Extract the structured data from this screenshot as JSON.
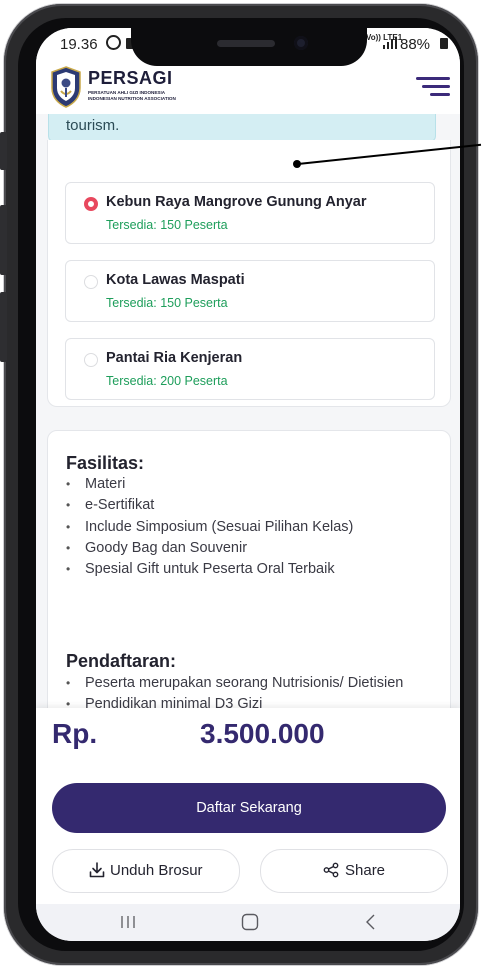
{
  "status_bar": {
    "time": "19.36",
    "network": "Vo)) LTE1",
    "battery": "88%"
  },
  "header": {
    "brand_name": "PERSAGI",
    "brand_sub_1": "PERSATUAN AHLI GIZI INDONESIA",
    "brand_sub_2": "INDONESIAN NUTRITION ASSOCIATION"
  },
  "info_banner": {
    "text": "tourism."
  },
  "options": [
    {
      "title": "Kebun Raya Mangrove Gunung Anyar",
      "availability": "Tersedia: 150 Peserta",
      "selected": true
    },
    {
      "title": "Kota Lawas Maspati",
      "availability": "Tersedia: 150 Peserta",
      "selected": false
    },
    {
      "title": "Pantai Ria Kenjeran",
      "availability": "Tersedia: 200 Peserta",
      "selected": false
    }
  ],
  "facilities": {
    "title": "Fasilitas:",
    "items": [
      "Materi",
      "e-Sertifikat",
      "Include Simposium (Sesuai Pilihan Kelas)",
      "Goody Bag dan Souvenir",
      "Spesial Gift untuk Peserta Oral Terbaik"
    ]
  },
  "registration": {
    "title": "Pendaftaran:",
    "items": [
      "Peserta merupakan seorang Nutrisionis/ Dietisien",
      "Pendidikan minimal D3 Gizi"
    ]
  },
  "price": {
    "currency": "Rp.",
    "amount": "3.500.000"
  },
  "actions": {
    "register_label": "Daftar Sekarang",
    "download_label": "Unduh Brosur",
    "share_label": "Share"
  },
  "icons": {
    "menu": "hamburger-menu-icon",
    "download": "download-icon",
    "share": "share-icon",
    "nav_recent": "recent-apps-icon",
    "nav_home": "home-icon",
    "nav_back": "back-icon"
  },
  "colors": {
    "primary": "#34296f",
    "radio_selected": "#e8485e",
    "availability_green": "#1e9e5b",
    "banner_bg": "#d4eef3"
  }
}
